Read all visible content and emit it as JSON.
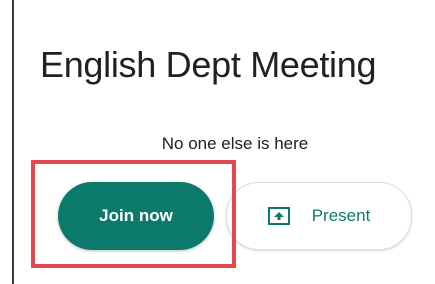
{
  "meeting": {
    "title": "English Dept Meeting",
    "status": "No one else is here"
  },
  "actions": {
    "join_label": "Join now",
    "present_label": "Present"
  },
  "icons": {
    "present": "present-screen-icon"
  },
  "colors": {
    "primary": "#0b7a6b",
    "highlight": "#e24a50"
  }
}
